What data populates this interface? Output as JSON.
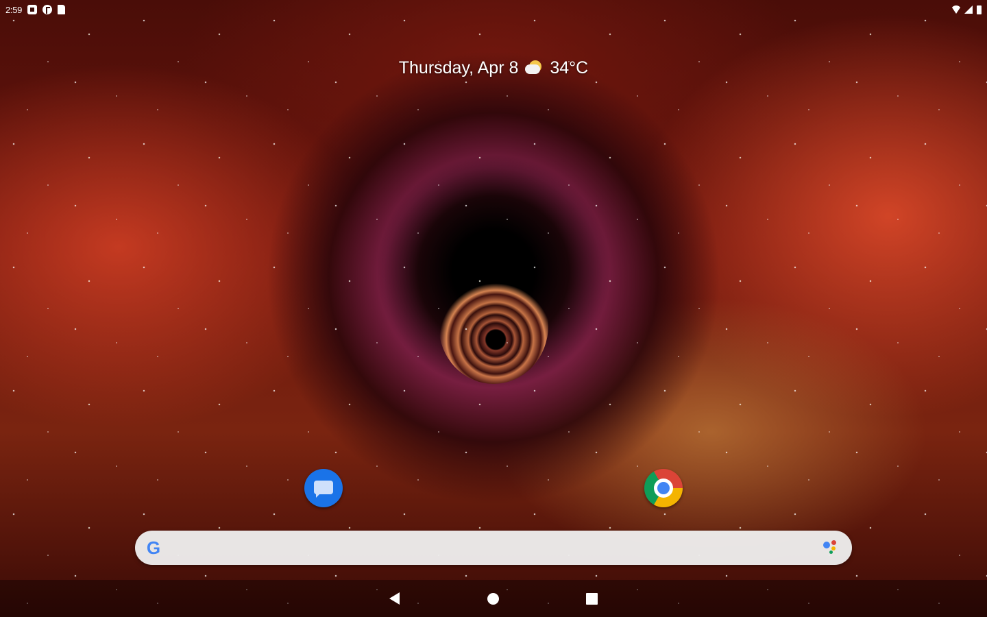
{
  "status_bar": {
    "time": "2:59",
    "icons": [
      "notification-square-icon",
      "notification-round-icon",
      "sd-card-icon"
    ],
    "right_icons": [
      "wifi-icon",
      "signal-icon",
      "battery-icon"
    ]
  },
  "glance": {
    "date": "Thursday, Apr 8",
    "weather_icon": "partly-cloudy-icon",
    "temperature": "34°C"
  },
  "home_apps": [
    {
      "name": "messages-app-icon"
    },
    {
      "name": "chrome-app-icon"
    }
  ],
  "search_bar": {
    "logo": "G",
    "right_icon": "google-assistant-icon"
  },
  "navigation": {
    "buttons": [
      "back-button",
      "home-button",
      "recents-button"
    ]
  },
  "colors": {
    "search_bar_bg": "#f0f0f0",
    "messages_blue": "#1a73e8",
    "google_blue": "#4285f4",
    "google_red": "#db4437",
    "google_yellow": "#f4b400",
    "google_green": "#0f9d58"
  }
}
